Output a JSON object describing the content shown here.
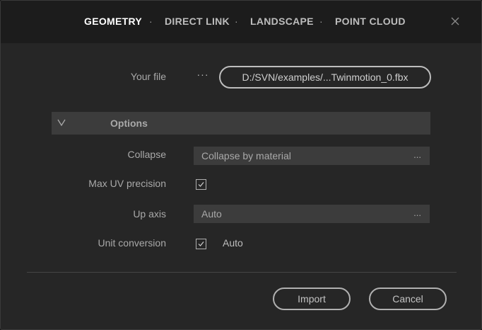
{
  "tabs": [
    {
      "label": "GEOMETRY",
      "active": true
    },
    {
      "label": "DIRECT LINK",
      "active": false
    },
    {
      "label": "LANDSCAPE",
      "active": false
    },
    {
      "label": "POINT CLOUD",
      "active": false
    }
  ],
  "tab_separator": "·",
  "close_icon": "close-icon",
  "file": {
    "label": "Your file",
    "browse_label": "···",
    "path": "D:/SVN/examples/...Twinmotion_0.fbx"
  },
  "options": {
    "title": "Options",
    "expanded": true,
    "collapse": {
      "label": "Collapse",
      "value": "Collapse by material",
      "more": "..."
    },
    "max_uv_precision": {
      "label": "Max UV precision",
      "checked": true
    },
    "up_axis": {
      "label": "Up axis",
      "value": "Auto",
      "more": "..."
    },
    "unit_conversion": {
      "label": "Unit conversion",
      "checked": true,
      "value": "Auto"
    }
  },
  "footer": {
    "import_label": "Import",
    "cancel_label": "Cancel"
  },
  "colors": {
    "background": "#262626",
    "header": "#1c1c1c",
    "field": "#3c3c3c",
    "text": "#a9a9a9",
    "active_tab": "#ffffff"
  }
}
